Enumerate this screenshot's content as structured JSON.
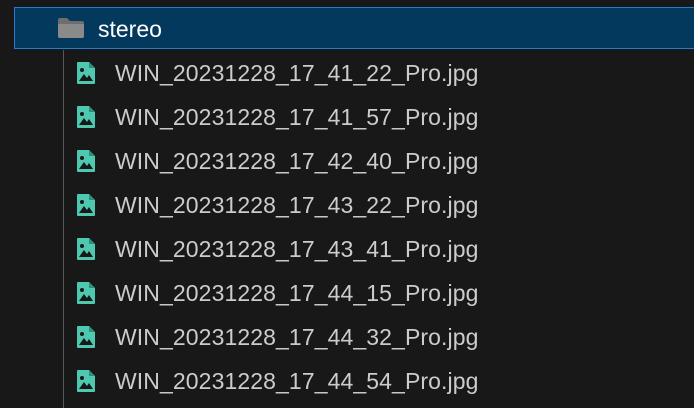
{
  "folder": {
    "name": "stereo",
    "icon": "folder-icon"
  },
  "files": [
    {
      "name": "WIN_20231228_17_41_22_Pro.jpg",
      "icon": "image-file-icon"
    },
    {
      "name": "WIN_20231228_17_41_57_Pro.jpg",
      "icon": "image-file-icon"
    },
    {
      "name": "WIN_20231228_17_42_40_Pro.jpg",
      "icon": "image-file-icon"
    },
    {
      "name": "WIN_20231228_17_43_22_Pro.jpg",
      "icon": "image-file-icon"
    },
    {
      "name": "WIN_20231228_17_43_41_Pro.jpg",
      "icon": "image-file-icon"
    },
    {
      "name": "WIN_20231228_17_44_15_Pro.jpg",
      "icon": "image-file-icon"
    },
    {
      "name": "WIN_20231228_17_44_32_Pro.jpg",
      "icon": "image-file-icon"
    },
    {
      "name": "WIN_20231228_17_44_54_Pro.jpg",
      "icon": "image-file-icon"
    }
  ],
  "colors": {
    "background": "#181818",
    "selection_bg": "#04395e",
    "selection_border": "#2b79d0",
    "text": "#cccccc",
    "image_icon": "#4ec9b0",
    "folder_icon": "#7a7a7a"
  }
}
